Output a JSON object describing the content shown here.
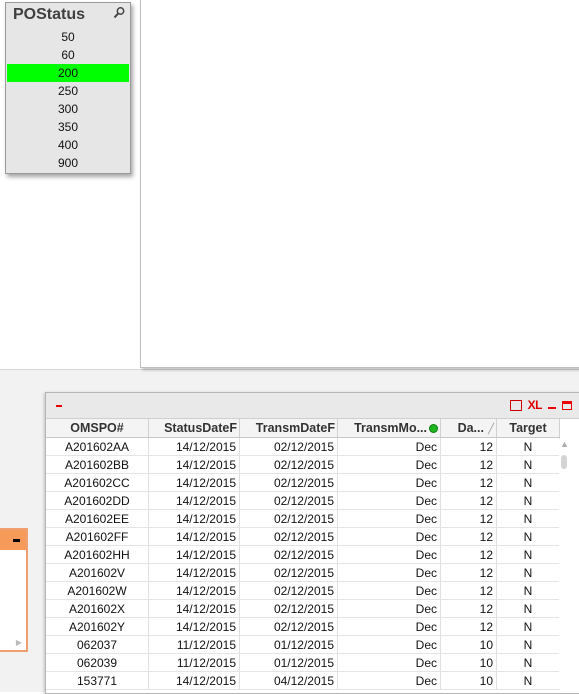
{
  "listbox": {
    "title": "POStatus",
    "items": [
      "50",
      "60",
      "200",
      "250",
      "300",
      "350",
      "400",
      "900"
    ],
    "selected": "200",
    "selected_color": "#00ff00"
  },
  "table": {
    "columns": [
      "OMSPO#",
      "StatusDateF",
      "TransmDateF",
      "TransmMo...",
      "Da...",
      "Target"
    ],
    "rows": [
      [
        "A201602AA",
        "14/12/2015",
        "02/12/2015",
        "Dec",
        "12",
        "N"
      ],
      [
        "A201602BB",
        "14/12/2015",
        "02/12/2015",
        "Dec",
        "12",
        "N"
      ],
      [
        "A201602CC",
        "14/12/2015",
        "02/12/2015",
        "Dec",
        "12",
        "N"
      ],
      [
        "A201602DD",
        "14/12/2015",
        "02/12/2015",
        "Dec",
        "12",
        "N"
      ],
      [
        "A201602EE",
        "14/12/2015",
        "02/12/2015",
        "Dec",
        "12",
        "N"
      ],
      [
        "A201602FF",
        "14/12/2015",
        "02/12/2015",
        "Dec",
        "12",
        "N"
      ],
      [
        "A201602HH",
        "14/12/2015",
        "02/12/2015",
        "Dec",
        "12",
        "N"
      ],
      [
        "A201602V",
        "14/12/2015",
        "02/12/2015",
        "Dec",
        "12",
        "N"
      ],
      [
        "A201602W",
        "14/12/2015",
        "02/12/2015",
        "Dec",
        "12",
        "N"
      ],
      [
        "A201602X",
        "14/12/2015",
        "02/12/2015",
        "Dec",
        "12",
        "N"
      ],
      [
        "A201602Y",
        "14/12/2015",
        "02/12/2015",
        "Dec",
        "12",
        "N"
      ],
      [
        "062037",
        "11/12/2015",
        "01/12/2015",
        "Dec",
        "10",
        "N"
      ],
      [
        "062039",
        "11/12/2015",
        "01/12/2015",
        "Dec",
        "10",
        "N"
      ],
      [
        "153771",
        "14/12/2015",
        "04/12/2015",
        "Dec",
        "10",
        "N"
      ]
    ],
    "caption_icons": {
      "xl": "XL"
    }
  },
  "colors": {
    "accent_orange": "#f59a59",
    "caption_red": "#e00000"
  }
}
